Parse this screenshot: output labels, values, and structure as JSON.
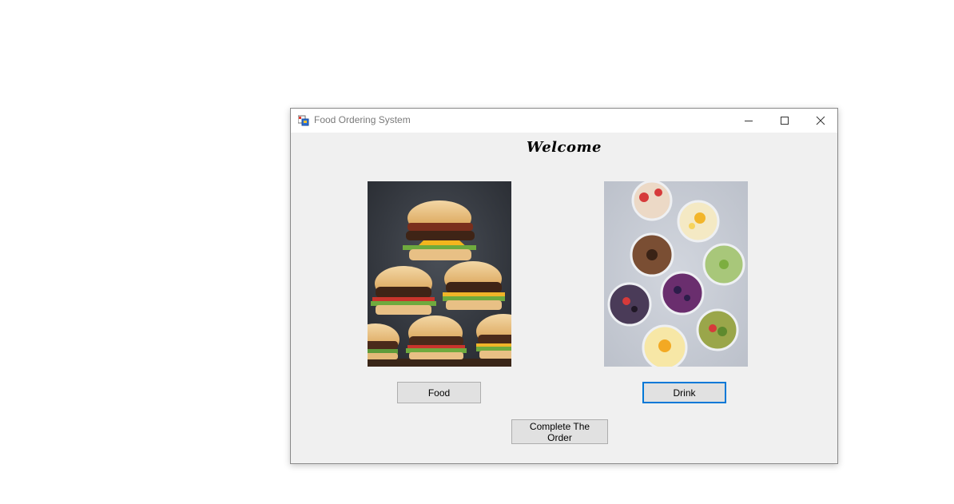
{
  "window": {
    "title": "Food Ordering System"
  },
  "form": {
    "heading": "Welcome",
    "food_button": "Food",
    "drink_button": "Drink",
    "complete_button": "Complete The Order"
  },
  "images": {
    "food": "stacked-burgers-photo",
    "drink": "smoothie-cups-photo"
  },
  "colors": {
    "window_bg": "#f0f0f0",
    "titlebar_bg": "#ffffff",
    "button_bg": "#e1e1e1",
    "focus_border": "#0078d7"
  }
}
